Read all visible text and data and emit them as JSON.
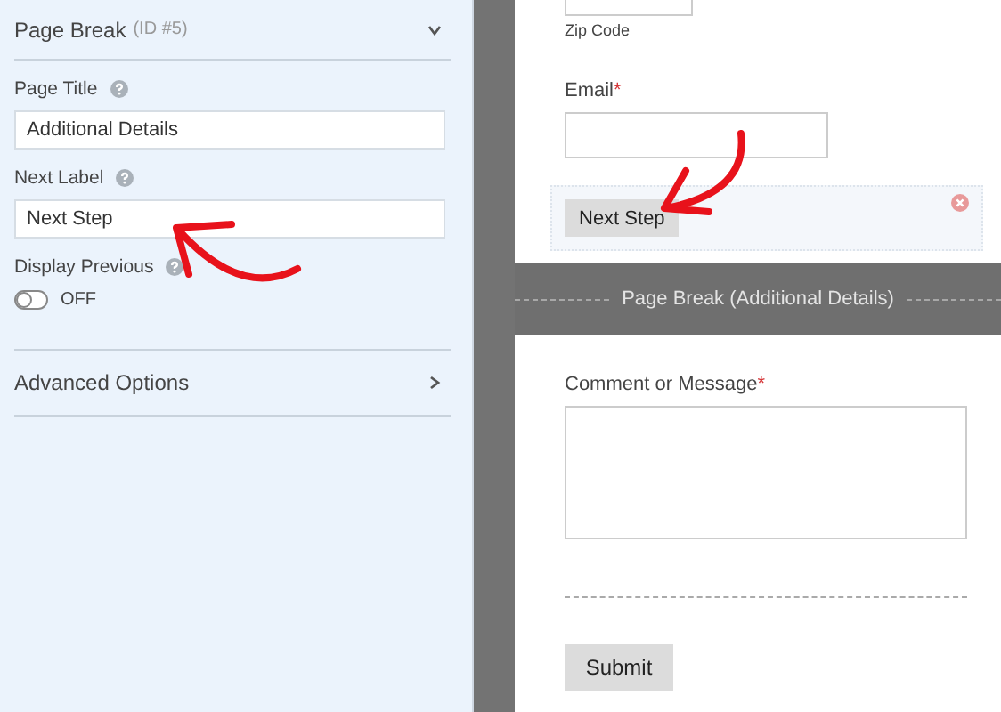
{
  "settings_panel": {
    "title": "Page Break",
    "id_text": "(ID #5)",
    "expanded": true,
    "fields": [
      {
        "label": "Page Title",
        "value": "Additional Details"
      },
      {
        "label": "Next Label",
        "value": "Next Step"
      }
    ],
    "toggle": {
      "label": "Display Previous",
      "on": false,
      "state_text": "OFF"
    },
    "sections": [
      {
        "label": "Advanced Options",
        "expanded": false
      }
    ]
  },
  "form_preview": {
    "zip_label": "Zip Code",
    "email": {
      "label": "Email",
      "required_mark": "*"
    },
    "next_button": "Next Step",
    "page_break": "Page Break (Additional Details)",
    "comment": {
      "label": "Comment or Message",
      "required_mark": "*"
    },
    "submit_button": "Submit"
  }
}
